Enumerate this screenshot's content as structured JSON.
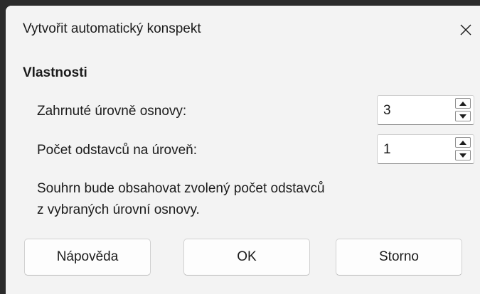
{
  "dialog": {
    "title": "Vytvořit automatický konspekt",
    "section_title": "Vlastnosti",
    "fields": [
      {
        "label": "Zahrnuté úrovně osnovy:",
        "value": "3"
      },
      {
        "label": "Počet odstavců na úroveň:",
        "value": "1"
      }
    ],
    "description_line1": "Souhrn bude obsahovat zvolený počet odstavců",
    "description_line2": "z vybraných úrovní osnovy.",
    "buttons": {
      "help": "Nápověda",
      "ok": "OK",
      "cancel": "Storno"
    }
  },
  "icons": {
    "close": "close-icon",
    "spin_up": "arrow-up-icon",
    "spin_down": "arrow-down-icon"
  }
}
